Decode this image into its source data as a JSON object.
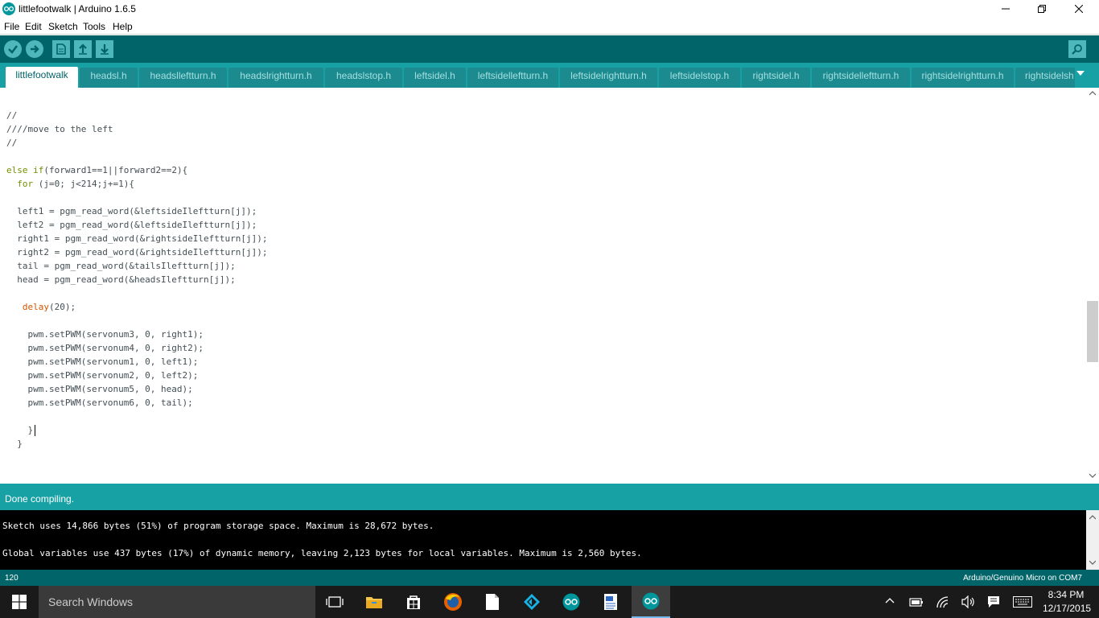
{
  "window": {
    "title": "littlefootwalk | Arduino 1.6.5"
  },
  "menu": [
    "File",
    "Edit",
    "Sketch",
    "Tools",
    "Help"
  ],
  "tabs": [
    "littlefootwalk",
    "headsl.h",
    "headslleftturn.h",
    "headslrightturn.h",
    "headslstop.h",
    "leftsidel.h",
    "leftsidelleftturn.h",
    "leftsidelrightturn.h",
    "leftsidelstop.h",
    "rightsidel.h",
    "rightsidelleftturn.h",
    "rightsidelrightturn.h",
    "rightsidels",
    "h"
  ],
  "code": [
    "//",
    "////move to the left",
    "//",
    "",
    "else if(forward1==1||forward2==2){",
    "  for (j=0; j<214;j+=1){",
    "",
    "  left1 = pgm_read_word(&leftsideIleftturn[j]);",
    "  left2 = pgm_read_word(&leftsideIleftturn[j]);",
    "  right1 = pgm_read_word(&rightsideIleftturn[j]);",
    "  right2 = pgm_read_word(&rightsideIleftturn[j]);",
    "  tail = pgm_read_word(&tailsIleftturn[j]);",
    "  head = pgm_read_word(&headsIleftturn[j]);",
    "",
    "   delay(20);",
    "",
    "    pwm.setPWM(servonum3, 0, right1);",
    "    pwm.setPWM(servonum4, 0, right2);",
    "    pwm.setPWM(servonum1, 0, left1);",
    "    pwm.setPWM(servonum2, 0, left2);",
    "    pwm.setPWM(servonum5, 0, head);",
    "    pwm.setPWM(servonum6, 0, tail);",
    "",
    "    }",
    "  }"
  ],
  "status": {
    "message": "Done compiling."
  },
  "console": [
    "Sketch uses 14,866 bytes (51%) of program storage space. Maximum is 28,672 bytes.",
    "Global variables use 437 bytes (17%) of dynamic memory, leaving 2,123 bytes for local variables. Maximum is 2,560 bytes."
  ],
  "footer": {
    "line_number": "120",
    "board": "Arduino/Genuino Micro on COM7"
  },
  "taskbar": {
    "search_placeholder": "Search Windows",
    "apps": [
      "task-view-icon",
      "file-explorer-icon",
      "store-icon",
      "firefox-icon",
      "document-icon",
      "kodi-icon",
      "arduino-icon",
      "wordpad-icon",
      "arduino-icon"
    ],
    "clock_time": "8:34 PM",
    "clock_date": "12/17/2015"
  },
  "colors": {
    "toolbar": "#006468",
    "tabstrip": "#17a1a5",
    "status": "#17a1a5",
    "console_bg": "#000000",
    "taskbar": "#1a1a1a"
  }
}
